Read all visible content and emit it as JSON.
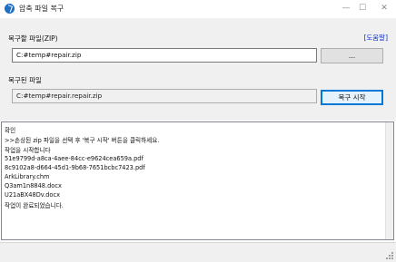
{
  "window": {
    "title": "압축 파일 복구",
    "minimize_glyph": "—",
    "maximize_glyph": "☐",
    "close_glyph": "✕"
  },
  "recover_section": {
    "label": "복구할 파일(ZIP)",
    "help_link": "[도움말]",
    "path_value": "C:#temp#repair.zip",
    "browse_label": "..."
  },
  "output_section": {
    "label": "복구된 파일",
    "path_value": "C:#temp#repair.repair.zip",
    "start_label": "복구 시작"
  },
  "log": {
    "lines": [
      "확인",
      ">>손상된 zip 파일을 선택 후 '복구 시작' 버튼을 클릭하세요.",
      "작업을 시작합니다",
      "51e9799d-a8ca-4aee-84cc-e9624cea659a.pdf",
      "8c9102a8-d664-45d1-9b68-7651bcbc7423.pdf",
      "ArkLibrary.chm",
      "Q3am1n8848.docx",
      "U21aBX48Dv.docx",
      "작업이 완료되었습니다."
    ]
  },
  "colors": {
    "accent": "#0078d7",
    "link": "#1033c8",
    "panel_bg": "#f0f0f0"
  },
  "icons": {
    "app": "app-logo-icon",
    "grip": "resize-grip-icon"
  }
}
